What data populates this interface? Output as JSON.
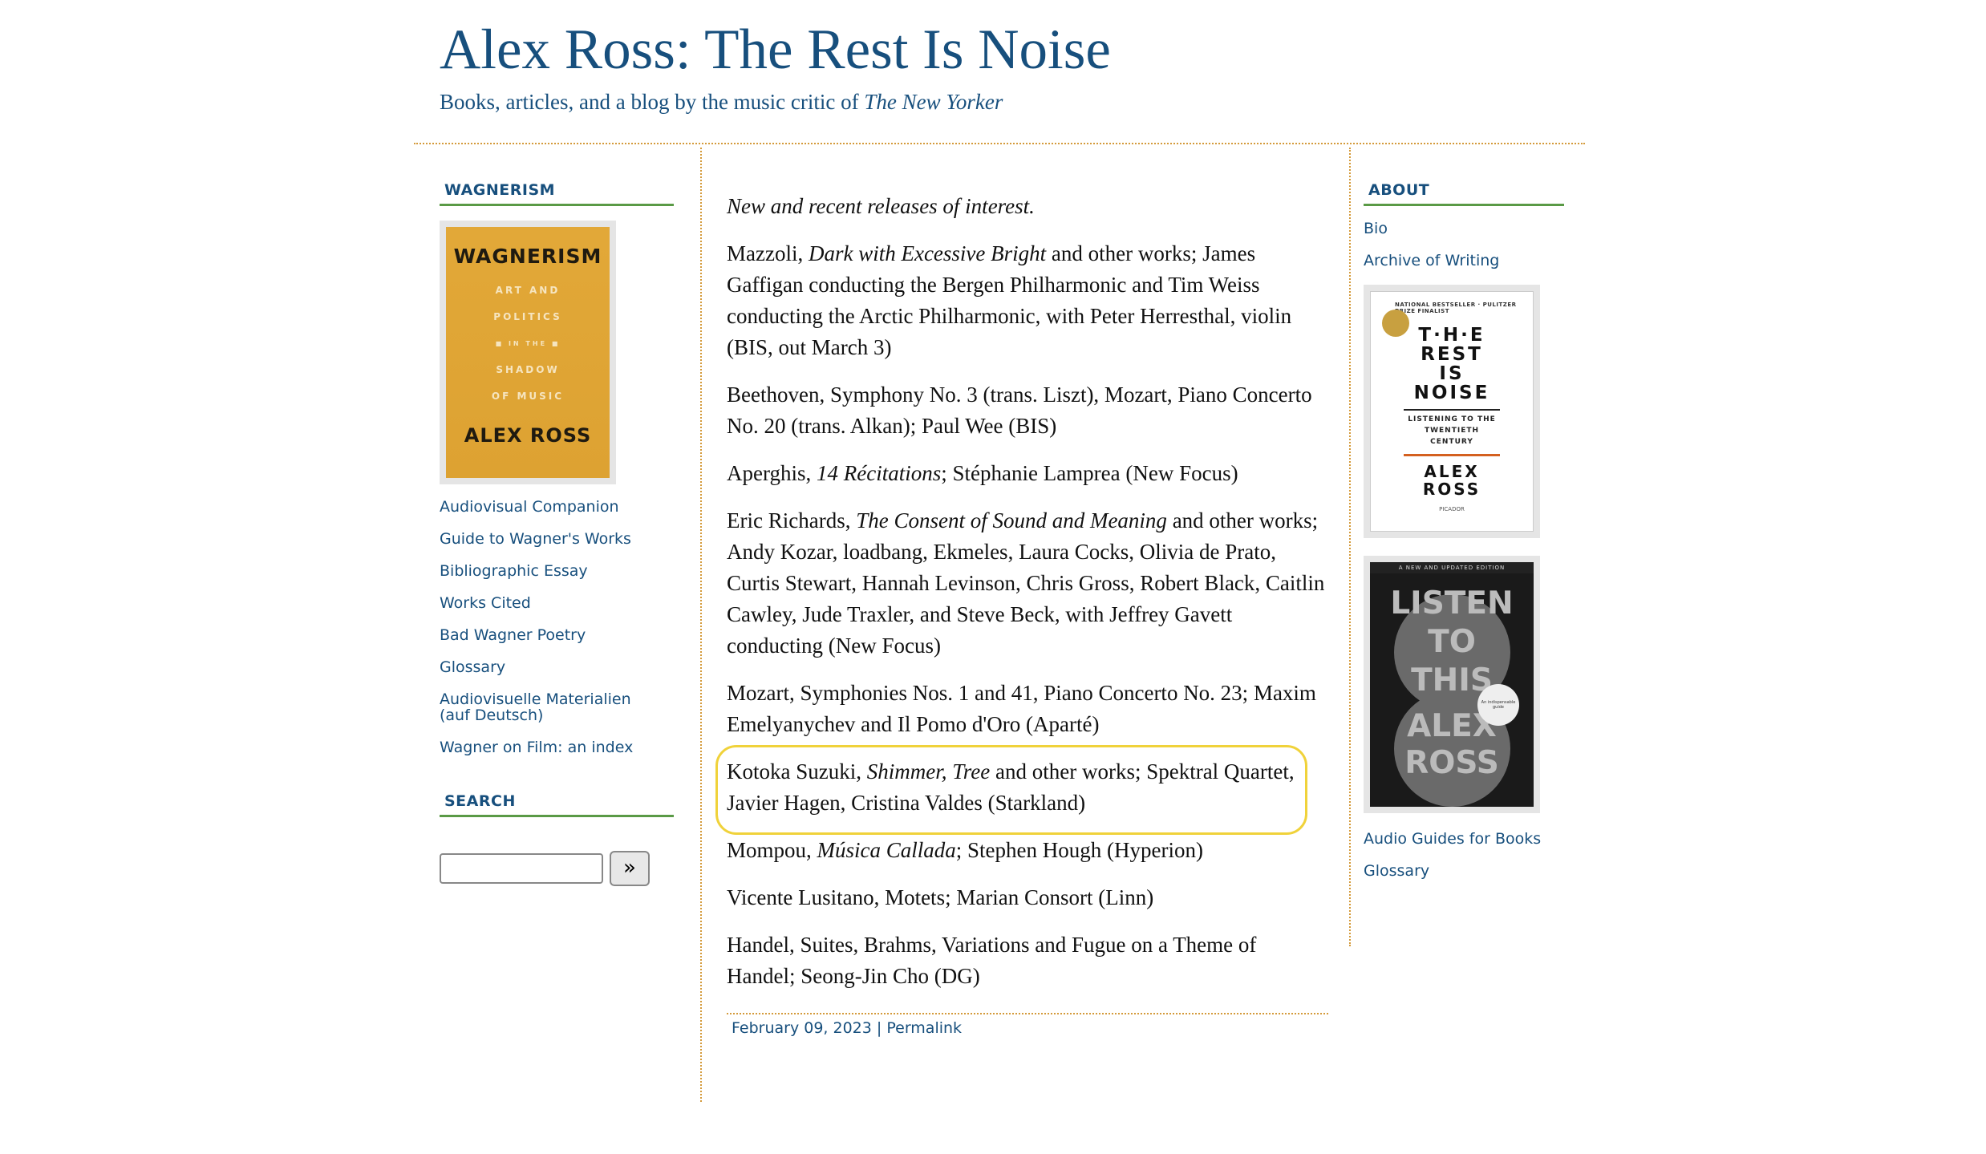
{
  "header": {
    "title": "Alex Ross: The Rest Is Noise",
    "tagline_prefix": "Books, articles, and a blog by the music critic of",
    "tagline_italic": "The New Yorker"
  },
  "left_sidebar": {
    "heading": "WAGNERISM",
    "book_cover": {
      "title": "WAGNERISM",
      "line1": "ART AND",
      "line2": "POLITICS",
      "line3": "IN THE",
      "line4": "SHADOW",
      "line5": "OF MUSIC",
      "author": "ALEX ROSS"
    },
    "links": [
      "Audiovisual Companion",
      "Guide to Wagner's Works",
      "Bibliographic Essay",
      "Works Cited",
      "Bad Wagner Poetry",
      "Glossary",
      "Audiovisuelle Materialien (auf Deutsch)",
      "Wagner on Film: an index"
    ],
    "search_heading": "SEARCH",
    "search_value": "",
    "search_button": "»"
  },
  "post": {
    "intro": "New and recent releases of interest.",
    "items": [
      {
        "a": "Mazzoli, ",
        "i": "Dark with Excessive Bright",
        "b": " and other works; James Gaffigan conducting the Bergen Philharmonic and Tim Weiss conducting the Arctic Philharmonic, with Peter Herresthal, violin (BIS, out March 3)"
      },
      {
        "a": "Beethoven, Symphony No. 3 (trans. Liszt), Mozart, Piano Concerto No. 20 (trans. Alkan); Paul Wee (BIS)",
        "i": "",
        "b": ""
      },
      {
        "a": "Aperghis, ",
        "i": "14 Récitations",
        "b": "; Stéphanie Lamprea (New Focus)"
      },
      {
        "a": "Eric Richards, ",
        "i": "The Consent of Sound and Meaning",
        "b": " and other works; Andy Kozar, loadbang, Ekmeles, Laura Cocks, Olivia de Prato, Curtis Stewart, Hannah Levinson, Chris Gross, Robert Black, Caitlin Cawley, Jude Traxler, and Steve Beck, with Jeffrey Gavett conducting (New Focus)"
      },
      {
        "a": "Mozart, Symphonies Nos. 1 and 41, Piano Concerto No. 23; Maxim Emelyanychev and Il Pomo d'Oro (Aparté)",
        "i": "",
        "b": ""
      },
      {
        "a": "Kotoka Suzuki, ",
        "i": "Shimmer, Tree",
        "b": " and other works; Spektral Quartet, Javier Hagen, Cristina Valdes (Starkland)"
      },
      {
        "a": "Mompou, ",
        "i": "Música Callada",
        "b": "; Stephen Hough (Hyperion)"
      },
      {
        "a": "Vicente Lusitano, Motets; Marian Consort (Linn)",
        "i": "",
        "b": ""
      },
      {
        "a": "Handel, Suites, Brahms, Variations and Fugue on a Theme of Handel; Seong-Jin Cho (DG)",
        "i": "",
        "b": ""
      }
    ],
    "date": "February 09, 2023",
    "separator": "|",
    "permalink": "Permalink"
  },
  "right_sidebar": {
    "heading": "ABOUT",
    "links_top": [
      "Bio",
      "Archive of Writing"
    ],
    "book1": {
      "small": "NATIONAL BESTSELLER · PULITZER PRIZE FINALIST",
      "title_lines": [
        "T·H·E",
        "REST",
        "IS",
        "NOISE"
      ],
      "sub": "LISTENING TO THE TWENTIETH CENTURY",
      "author_lines": [
        "ALEX",
        "ROSS"
      ],
      "publisher": "PICADOR"
    },
    "book2": {
      "ribbon": "A NEW AND UPDATED EDITION",
      "title_lines": [
        "LISTEN",
        "TO",
        "THIS"
      ],
      "author_lines": [
        "ALEX",
        "ROSS"
      ],
      "sticker": "An indispensable guide"
    },
    "links_bottom": [
      "Audio Guides for Books",
      "Glossary"
    ]
  },
  "colors": {
    "link_blue": "#174f7d",
    "rule_orange": "#d49a3a",
    "heading_underline": "#5a9a46",
    "highlight_yellow": "#f0d23a"
  }
}
